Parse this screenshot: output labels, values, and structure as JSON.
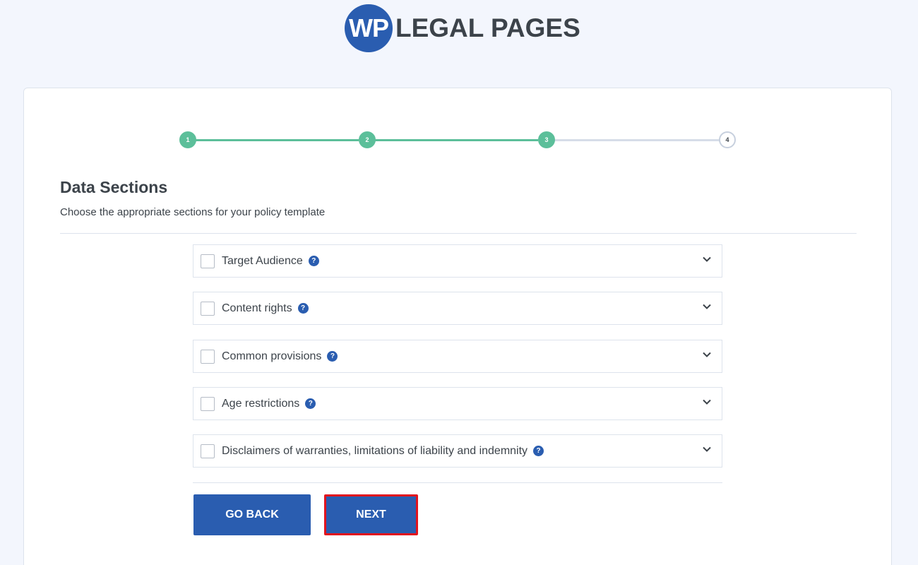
{
  "logo": {
    "badge": "WP",
    "text": "LEGAL PAGES"
  },
  "stepper": {
    "steps": [
      "1",
      "2",
      "3",
      "4"
    ],
    "current": 3
  },
  "header": {
    "title": "Data Sections",
    "subtitle": "Choose the appropriate sections for your policy template"
  },
  "sections": [
    {
      "label": "Target Audience",
      "checked": false
    },
    {
      "label": "Content rights",
      "checked": false
    },
    {
      "label": "Common provisions",
      "checked": false
    },
    {
      "label": "Age restrictions",
      "checked": false
    },
    {
      "label": "Disclaimers of warranties, limitations of liability and indemnity",
      "checked": false
    }
  ],
  "help_icon_glyph": "?",
  "buttons": {
    "back": "GO BACK",
    "next": "NEXT"
  },
  "colors": {
    "accent": "#2a5db0",
    "step_done": "#5cbf9a",
    "highlight": "#e1141e"
  }
}
